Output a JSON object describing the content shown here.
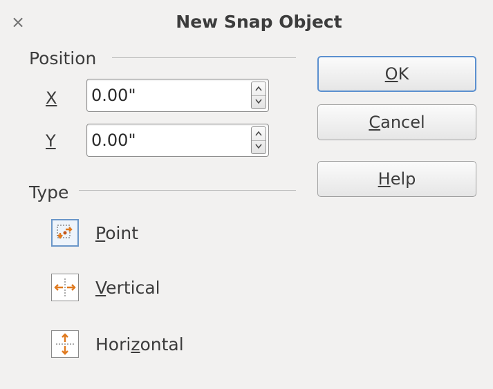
{
  "dialog": {
    "title": "New Snap Object",
    "close_glyph": "×"
  },
  "position": {
    "label": "Position",
    "x_label": "X",
    "x_value": "0.00\"",
    "y_label": "Y",
    "y_value": "0.00\""
  },
  "type": {
    "label": "Type",
    "options": [
      {
        "pre": "",
        "mnemonic": "P",
        "post": "oint",
        "icon": "snap-point-icon",
        "selected": true
      },
      {
        "pre": "",
        "mnemonic": "V",
        "post": "ertical",
        "icon": "snap-vertical-icon",
        "selected": false
      },
      {
        "pre": "Hori",
        "mnemonic": "z",
        "post": "ontal",
        "icon": "snap-horizontal-icon",
        "selected": false
      }
    ]
  },
  "buttons": {
    "ok": {
      "pre": "",
      "mnemonic": "O",
      "post": "K"
    },
    "cancel": {
      "pre": "",
      "mnemonic": "C",
      "post": "ancel"
    },
    "help": {
      "pre": "",
      "mnemonic": "H",
      "post": "elp"
    }
  },
  "colors": {
    "background": "#f2f1f0",
    "default_button_border": "#5a8fcf",
    "icon_accent": "#e07a1f"
  }
}
